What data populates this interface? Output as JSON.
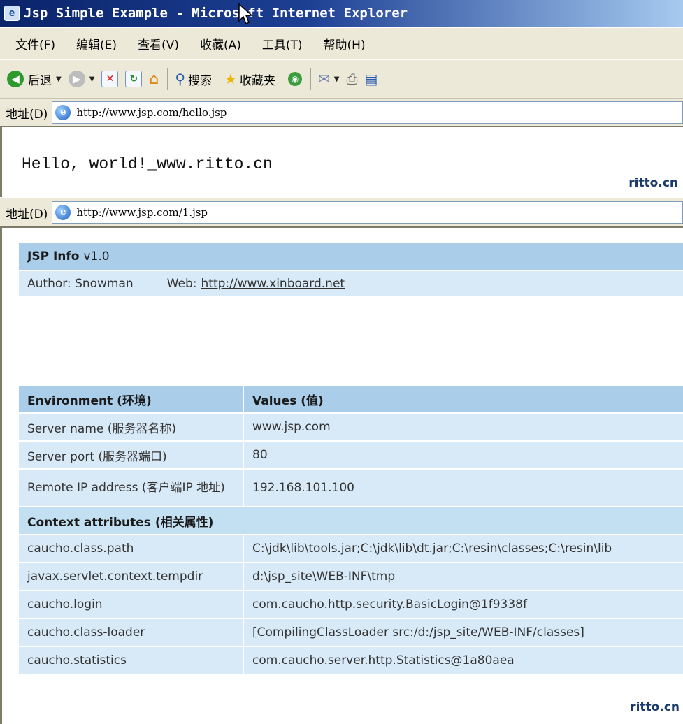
{
  "window1": {
    "title": "Jsp Simple Example - Microsoft Internet Explorer",
    "menu": [
      "文件(F)",
      "编辑(E)",
      "查看(V)",
      "收藏(A)",
      "工具(T)",
      "帮助(H)"
    ],
    "toolbar": {
      "back": "后退",
      "search": "搜索",
      "favorites": "收藏夹"
    },
    "address_label": "地址(D)",
    "url": "http://www.jsp.com/hello.jsp",
    "body_text": "Hello, world!_www.ritto.cn",
    "watermark": "ritto.cn"
  },
  "window2": {
    "address_label": "地址(D)",
    "url": "http://www.jsp.com/1.jsp",
    "info": {
      "title": "JSP Info",
      "version": "v1.0",
      "author": "Author: Snowman",
      "web_label": "Web:",
      "web_link": "http://www.xinboard.net"
    },
    "table": {
      "headers": [
        "Environment (环境)",
        "Values (值)"
      ],
      "rows": [
        {
          "key": "Server name (服务器名称)",
          "value": "www.jsp.com"
        },
        {
          "key": "Server port (服务器端口)",
          "value": "80"
        },
        {
          "key": "Remote IP address (客户端IP 地址)",
          "value": "192.168.101.100"
        }
      ],
      "section": "Context attributes (相关属性)",
      "attrs": [
        {
          "key": "caucho.class.path",
          "value": "C:\\jdk\\lib\\tools.jar;C:\\jdk\\lib\\dt.jar;C:\\resin\\classes;C:\\resin\\lib"
        },
        {
          "key": "javax.servlet.context.tempdir",
          "value": "d:\\jsp_site\\WEB-INF\\tmp"
        },
        {
          "key": "caucho.login",
          "value": "com.caucho.http.security.BasicLogin@1f9338f"
        },
        {
          "key": "caucho.class-loader",
          "value": "[CompilingClassLoader src:/d:/jsp_site/WEB-INF/classes]"
        },
        {
          "key": "caucho.statistics",
          "value": "com.caucho.server.http.Statistics@1a80aea"
        }
      ]
    },
    "watermark": "ritto.cn"
  },
  "colors": {
    "titlebar": "#0a246a",
    "header": "#aacdea",
    "row": "#d8eaf8"
  }
}
